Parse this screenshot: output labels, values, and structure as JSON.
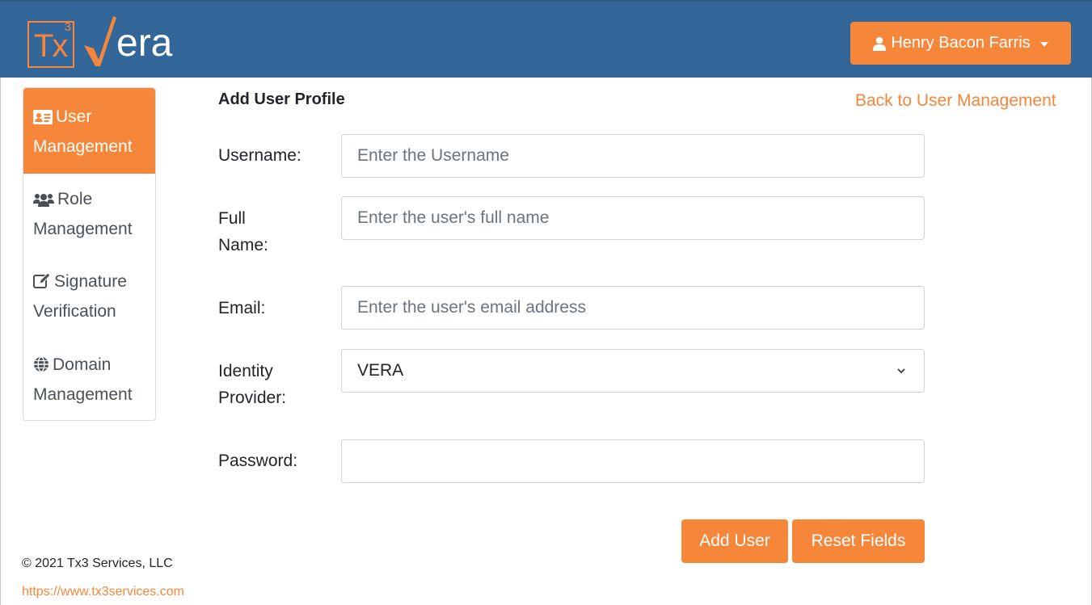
{
  "header": {
    "logo": {
      "tx": "Tx",
      "sup": "3",
      "era": "era"
    },
    "user_name": "Henry Bacon Farris",
    "colors": {
      "header_bg": "#336699",
      "accent": "#f6863a"
    }
  },
  "sidebar": {
    "items": [
      {
        "line1": "User",
        "line2": "Management",
        "icon": "id-card-icon",
        "active": true
      },
      {
        "line1": "Role",
        "line2": "Management",
        "icon": "users-icon",
        "active": false
      },
      {
        "line1": "Signature",
        "line2": "Verification",
        "icon": "edit-icon",
        "active": false
      },
      {
        "line1": "Domain",
        "line2": "Management",
        "icon": "globe-icon",
        "active": false
      }
    ]
  },
  "main": {
    "title": "Add User Profile",
    "back_link": "Back to User Management",
    "form": {
      "username": {
        "label": "Username:",
        "placeholder": "Enter the Username",
        "value": ""
      },
      "full_name": {
        "label_line1": "Full",
        "label_line2": "Name:",
        "placeholder": "Enter the user's full name",
        "value": ""
      },
      "email": {
        "label": "Email:",
        "placeholder": "Enter the user's email address",
        "value": ""
      },
      "identity_provider": {
        "label_line1": "Identity",
        "label_line2": "Provider:",
        "selected": "VERA"
      },
      "password": {
        "label": "Password:",
        "value": ""
      }
    },
    "buttons": {
      "add": "Add User",
      "reset": "Reset Fields"
    }
  },
  "footer": {
    "copyright": "© 2021 Tx3 Services, LLC",
    "link": "https://www.tx3services.com"
  }
}
